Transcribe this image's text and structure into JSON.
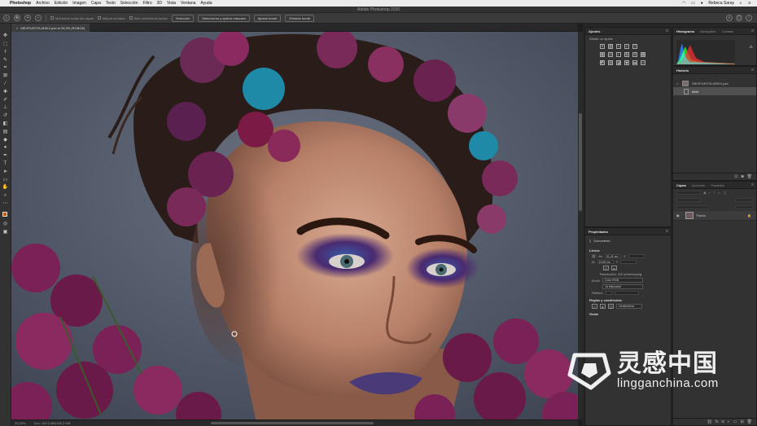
{
  "menubar": {
    "app_name": "Photoshop",
    "items": [
      "Archivo",
      "Edición",
      "Imagen",
      "Capa",
      "Texto",
      "Selección",
      "Filtro",
      "3D",
      "Vista",
      "Ventana",
      "Ayuda"
    ],
    "user_name": "Rebeca Saray"
  },
  "window": {
    "title": "Adobe Photoshop 2020"
  },
  "options_bar": {
    "checkbox_1": "Muestrear todas las capas",
    "checkbox_2": "Mejora ventana",
    "checkbox_3": "Sólo movimiento suave",
    "btn_1": "Selección",
    "btn_2": "Seleccionar y aplicar máscara",
    "btn_3": "Ajustar borde",
    "btn_4": "Eliminar borde"
  },
  "document": {
    "tab_title": "MEXPUESTA-MSK2.psd al 33,3% (RGB/16)",
    "zoom": "33,33%",
    "doc_info": "Doc: 105,2 MB/105,2 MB"
  },
  "adjustments_panel": {
    "tab": "Ajustes",
    "hint": "Añadir un ajuste"
  },
  "histogram_panel": {
    "tabs": [
      "Histograma",
      "Navegador",
      "Canales"
    ],
    "colors": {
      "red": "#ff3030",
      "green": "#30ff30",
      "blue": "#3080ff",
      "cyan": "#30ffff"
    }
  },
  "history_panel": {
    "tab": "Historia",
    "items": [
      "MEXPUESTA-MSK2.psd",
      "Abrir"
    ]
  },
  "properties_panel": {
    "tab": "Propiedades",
    "type": "Documento",
    "section_canvas": "Lienzo",
    "width": "31,42 cm",
    "height": "19,65 cm",
    "resolution": "Resolución: 300 píxeles/pulg.",
    "mode_label": "Modo",
    "mode_value": "Color RGB",
    "depth_value": "16 bits/canal",
    "fill_label": "Relleno",
    "section_rulers": "Reglas y cuadrículas",
    "unit": "Centímetros",
    "section_guides": "Guías"
  },
  "layers_panel": {
    "tabs": [
      "Capas",
      "Acciones",
      "Trazados"
    ],
    "layers": [
      {
        "name": "Fondo"
      }
    ]
  },
  "watermark": {
    "cn": "灵感中国",
    "en": "lingganchina.com"
  }
}
